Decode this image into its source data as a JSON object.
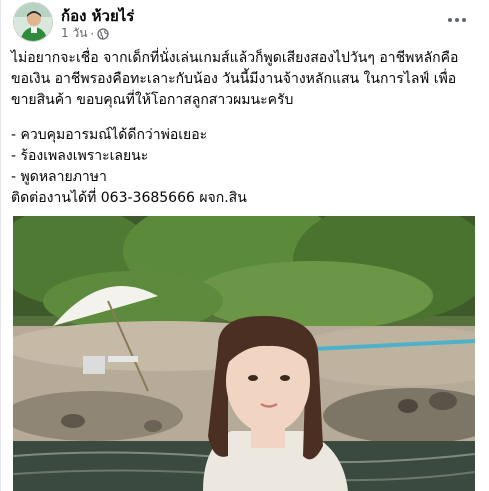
{
  "post": {
    "author": "ก้อง ห้วยไร่",
    "time": "1 วัน",
    "separator": "·",
    "privacy_icon": "globe-icon",
    "paragraph_line1": "ไม่อยากจะเชื่อ จากเด็กที่นั่งเล่นเกมส์แล้วก็พูดเสียงสองไปวันๆ อาชีพหลักคือ",
    "paragraph_line2": "ขอเงิน อาชีพรองคือทะเลาะกับน้อง วันนี้มีงานจ้างหลักแสน ในการไลฟ์ เพื่อ",
    "paragraph_line3": "ขายสินค้า ขอบคุณที่ให้โอกาสลูกสาวผมนะครับ",
    "list": [
      "- ควบคุมอารมณ์ได้ดีกว่าพ่อเยอะ",
      "- ร้องเพลงเพราะเลยนะ",
      "- พูดหลายภาษา"
    ],
    "contact": "ติดต่องานได้ที่  063-3685666 ผจก.สิน"
  },
  "colors": {
    "text": "#050505",
    "secondary": "#65676b"
  }
}
